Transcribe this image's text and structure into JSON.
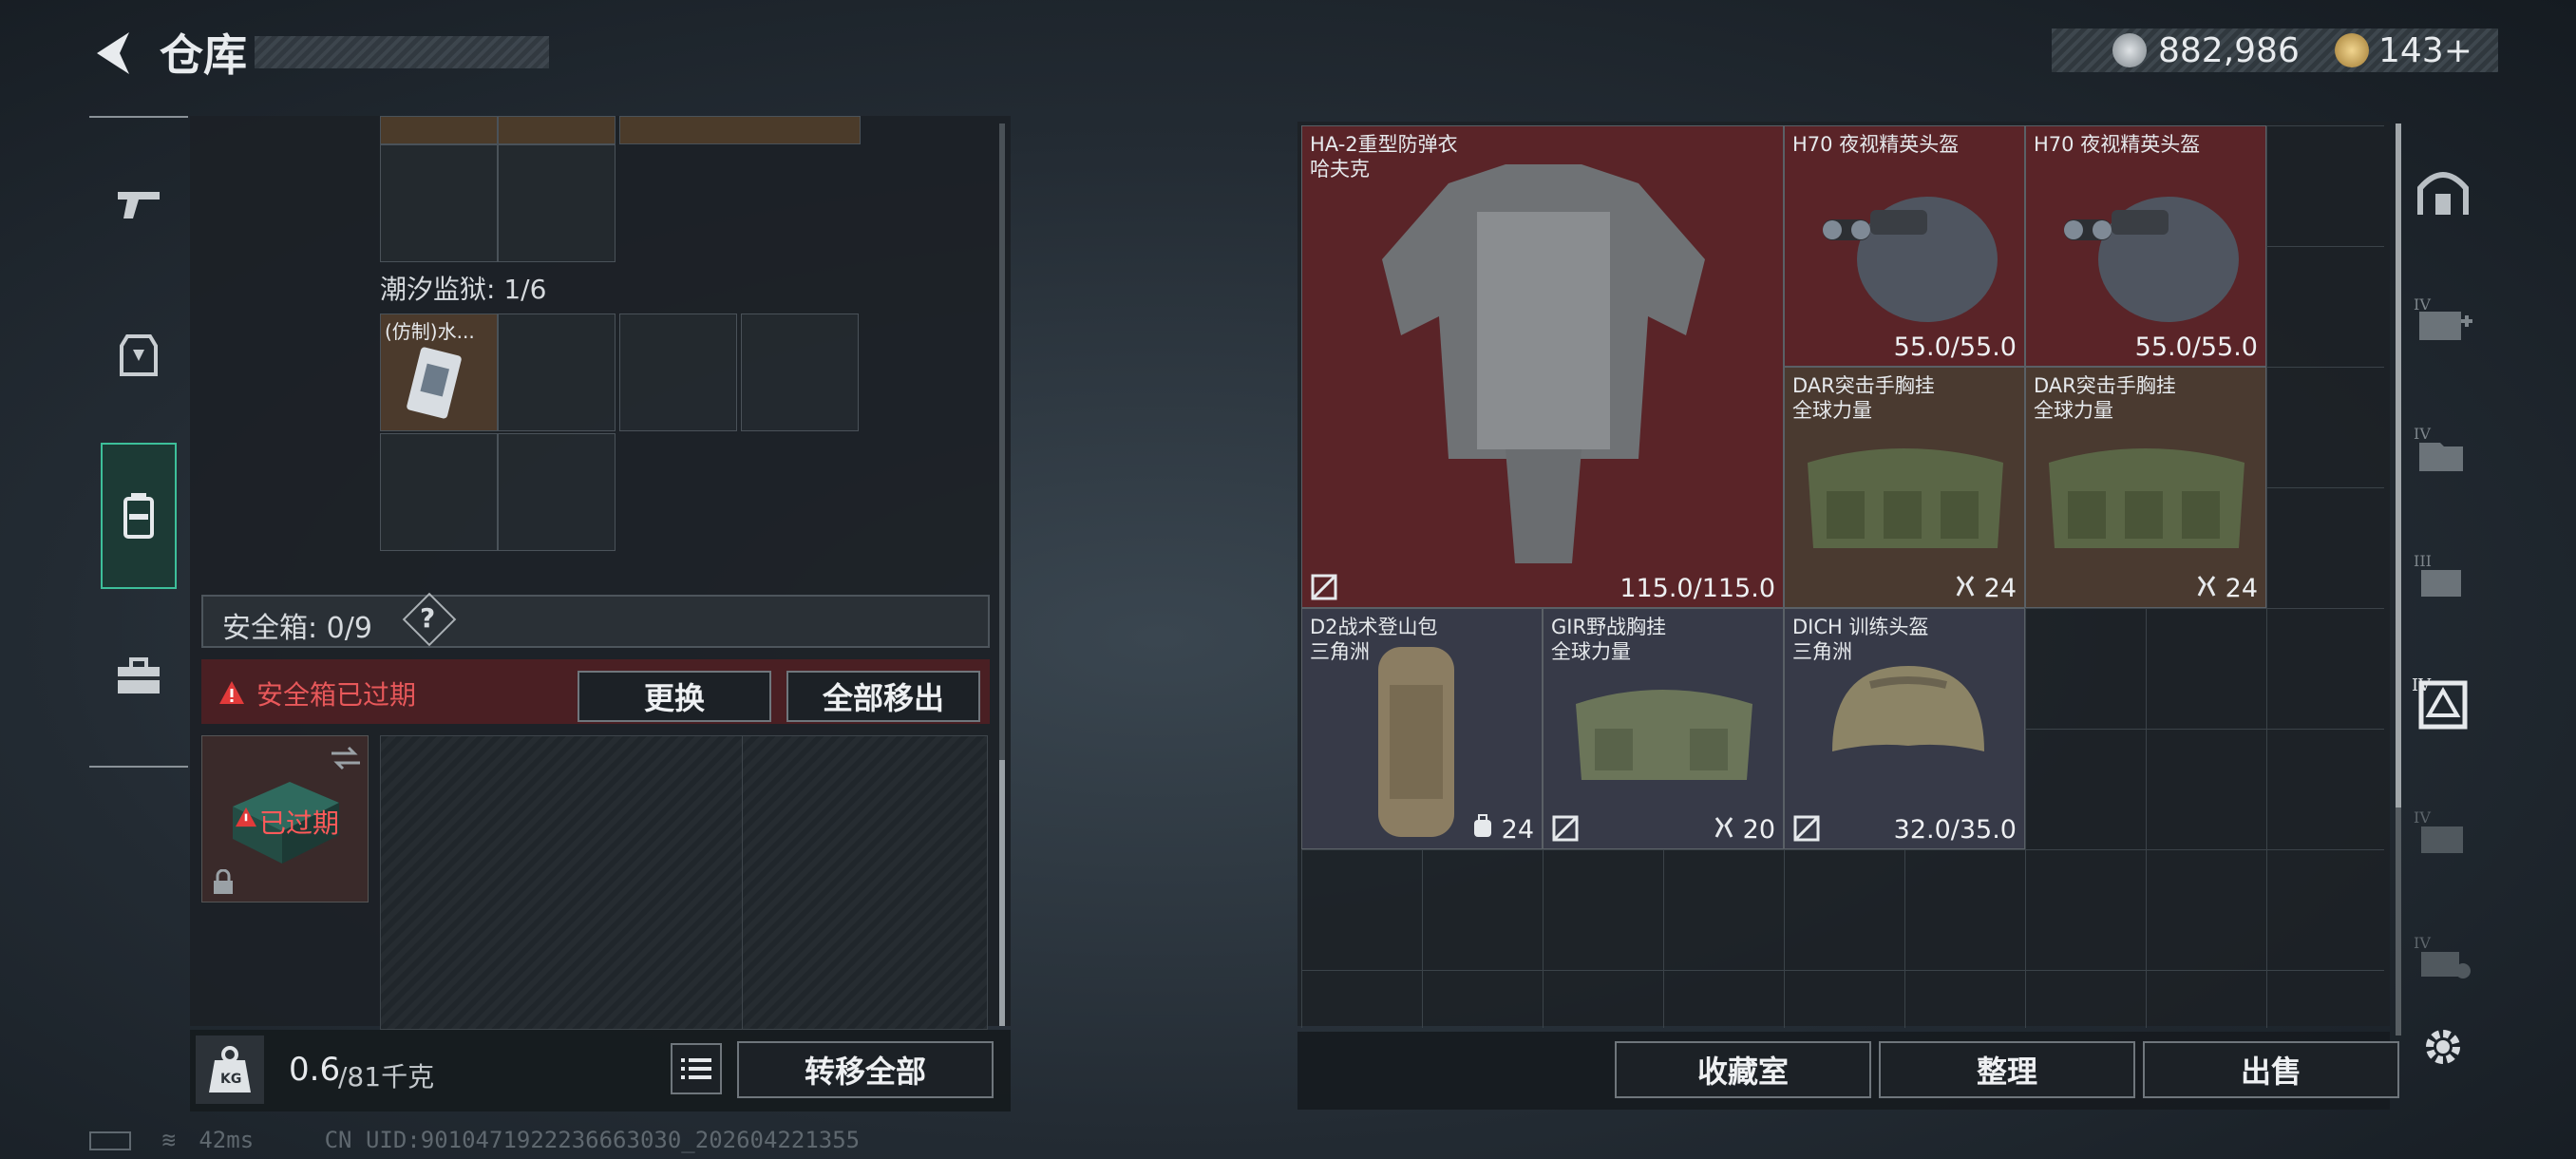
{
  "header": {
    "title": "仓库",
    "currency_1": "882,986",
    "currency_2": "143+"
  },
  "left": {
    "tidal_prison_label": "潮汐监狱: 1/6",
    "tidal_item_name": "(仿制)水...",
    "safe_box_label": "安全箱: 0/9",
    "safe_box_help": "?",
    "expired_warning": "安全箱已过期",
    "replace_button": "更换",
    "move_all_out_button": "全部移出",
    "box_tile_status": "已过期",
    "weight_value": "0.6",
    "weight_capacity": "/81千克",
    "transfer_all_button": "转移全部"
  },
  "stash_items": [
    {
      "id": "armor",
      "name_line1": "HA-2重型防弹衣",
      "name_line2": "哈夫克",
      "value": "115.0/115.0",
      "bg": "#5a2428"
    },
    {
      "id": "helmet1",
      "name_line1": "H70 夜视精英头盔",
      "name_line2": "",
      "value": "55.0/55.0",
      "bg": "#5a2428"
    },
    {
      "id": "helmet2",
      "name_line1": "H70 夜视精英头盔",
      "name_line2": "",
      "value": "55.0/55.0",
      "bg": "#5a2428"
    },
    {
      "id": "rig1",
      "name_line1": "DAR突击手胸挂",
      "name_line2": "全球力量",
      "value": "24",
      "bg": "#4a3a30"
    },
    {
      "id": "rig2",
      "name_line1": "DAR突击手胸挂",
      "name_line2": "全球力量",
      "value": "24",
      "bg": "#4a3a30"
    },
    {
      "id": "backpack",
      "name_line1": "D2战术登山包",
      "name_line2": "三角洲",
      "value": "24",
      "bg": "#373a48"
    },
    {
      "id": "rig3",
      "name_line1": "GIR野战胸挂",
      "name_line2": "全球力量",
      "value": "20",
      "bg": "#373a48"
    },
    {
      "id": "helmet3",
      "name_line1": "DICH 训练头盔",
      "name_line2": "三角洲",
      "value": "32.0/35.0",
      "bg": "#373a48"
    }
  ],
  "right_bar": {
    "collection_button": "收藏室",
    "sort_button": "整理",
    "sell_button": "出售"
  },
  "footer": {
    "ping": "42ms",
    "uid": "CN UID:9010471922236663030_202604221355"
  },
  "colors": {
    "accent_green": "#3dbf9a",
    "expired_red": "#e23a3a",
    "rare_red": "#5a2428",
    "epic_bronze": "#4a3a30",
    "common_slate": "#373a48"
  }
}
